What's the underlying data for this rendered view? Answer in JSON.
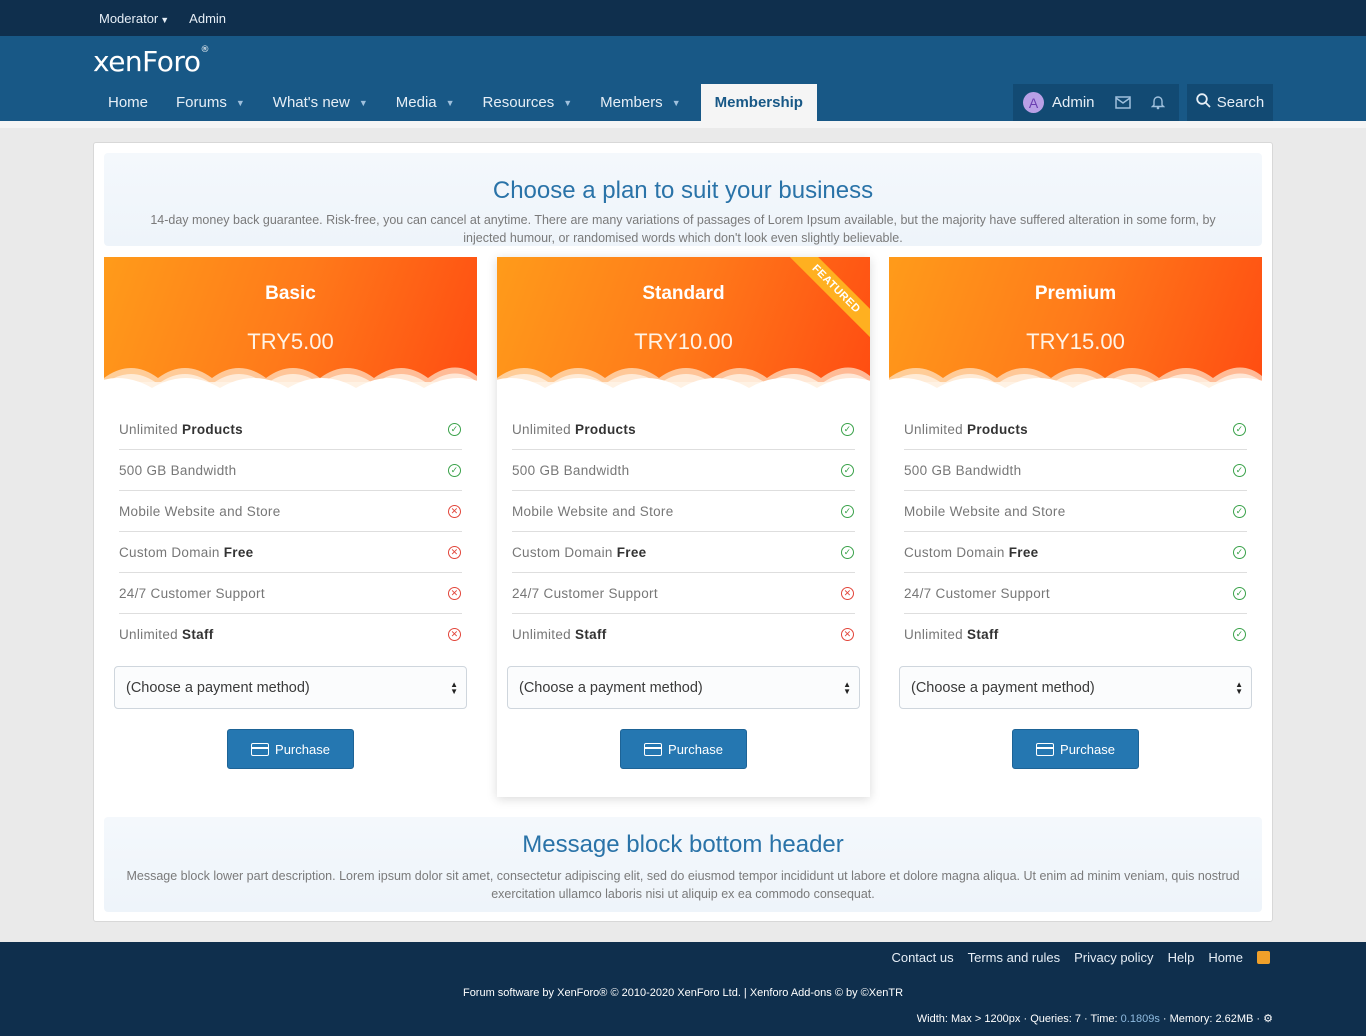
{
  "staffbar": {
    "moderator": "Moderator",
    "admin": "Admin"
  },
  "logo": {
    "text": "xenForo",
    "reg": "®"
  },
  "nav": {
    "items": [
      {
        "label": "Home",
        "dropdown": false
      },
      {
        "label": "Forums",
        "dropdown": true
      },
      {
        "label": "What's new",
        "dropdown": true
      },
      {
        "label": "Media",
        "dropdown": true
      },
      {
        "label": "Resources",
        "dropdown": true
      },
      {
        "label": "Members",
        "dropdown": true
      }
    ],
    "active": "Membership"
  },
  "user": {
    "avatar_letter": "A",
    "name": "Admin"
  },
  "search": {
    "label": "Search"
  },
  "top_block": {
    "title": "Choose a plan to suit your business",
    "description": "14-day money back guarantee. Risk-free, you can cancel at anytime. There are many variations of passages of Lorem Ipsum available, but the majority have suffered alteration in some form, by injected humour, or randomised words which don't look even slightly believable."
  },
  "plans": [
    {
      "title": "Basic",
      "price": "TRY5.00",
      "featured": false,
      "features": [
        {
          "text": "Unlimited ",
          "bold": "Products",
          "ok": true
        },
        {
          "text": "500 GB Bandwidth",
          "bold": "",
          "ok": true
        },
        {
          "text": "Mobile Website and Store",
          "bold": "",
          "ok": false
        },
        {
          "text": "Custom Domain ",
          "bold": "Free",
          "ok": false
        },
        {
          "text": "24/7 Customer Support",
          "bold": "",
          "ok": false
        },
        {
          "text": "Unlimited ",
          "bold": "Staff",
          "ok": false
        }
      ]
    },
    {
      "title": "Standard",
      "price": "TRY10.00",
      "featured": true,
      "ribbon": "FEATURED",
      "features": [
        {
          "text": "Unlimited ",
          "bold": "Products",
          "ok": true
        },
        {
          "text": "500 GB Bandwidth",
          "bold": "",
          "ok": true
        },
        {
          "text": "Mobile Website and Store",
          "bold": "",
          "ok": true
        },
        {
          "text": "Custom Domain ",
          "bold": "Free",
          "ok": true
        },
        {
          "text": "24/7 Customer Support",
          "bold": "",
          "ok": false
        },
        {
          "text": "Unlimited ",
          "bold": "Staff",
          "ok": false
        }
      ]
    },
    {
      "title": "Premium",
      "price": "TRY15.00",
      "featured": false,
      "features": [
        {
          "text": "Unlimited ",
          "bold": "Products",
          "ok": true
        },
        {
          "text": "500 GB Bandwidth",
          "bold": "",
          "ok": true
        },
        {
          "text": "Mobile Website and Store",
          "bold": "",
          "ok": true
        },
        {
          "text": "Custom Domain ",
          "bold": "Free",
          "ok": true
        },
        {
          "text": "24/7 Customer Support",
          "bold": "",
          "ok": true
        },
        {
          "text": "Unlimited ",
          "bold": "Staff",
          "ok": true
        }
      ]
    }
  ],
  "payment_select": {
    "value": "(Choose a payment method)"
  },
  "purchase_label": "Purchase",
  "bottom_block": {
    "title": "Message block bottom header",
    "description": "Message block lower part description. Lorem ipsum dolor sit amet, consectetur adipiscing elit, sed do eiusmod tempor incididunt ut labore et dolore magna aliqua. Ut enim ad minim veniam, quis nostrud exercitation ullamco laboris nisi ut aliquip ex ea commodo consequat."
  },
  "footer": {
    "links": [
      "Contact us",
      "Terms and rules",
      "Privacy policy",
      "Help",
      "Home"
    ],
    "copyright": "Forum software by XenForo® © 2010-2020 XenForo Ltd. | Xenforo Add-ons © by ©XenTR",
    "debug_prefix": "Width: Max > 1200px · Queries: 7 · Time: ",
    "debug_time": "0.1809s",
    "debug_suffix": " · Memory: 2.62MB · "
  },
  "colors": {
    "header": "#185886",
    "staffbar": "#0f2f4d",
    "accent": "#2577b1",
    "plan_orange": "#ff7a1a",
    "ok": "#3aa24a",
    "no": "#e2453a"
  },
  "icons": {
    "dropdown": "chevron-down-icon",
    "mail": "envelope-icon",
    "bell": "bell-icon",
    "search": "search-icon",
    "card": "credit-card-icon",
    "rss": "rss-icon",
    "gear": "gear-icon"
  }
}
